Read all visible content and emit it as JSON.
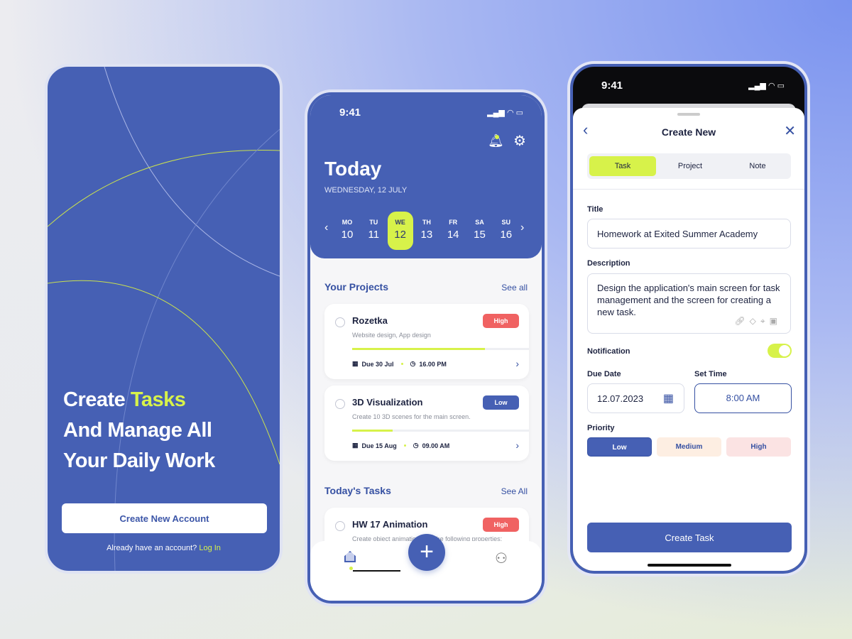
{
  "colors": {
    "primary": "#4660b4",
    "accent": "#d7f24a",
    "high": "#f06262",
    "low": "#4660b4"
  },
  "onboarding": {
    "headline_1a": "Create ",
    "headline_1b": "Tasks",
    "headline_2": "And Manage All",
    "headline_3": "Your Daily Work",
    "create_account": "Create New Account",
    "have_account": "Already have an account? ",
    "login": "Log In"
  },
  "home": {
    "time": "9:41",
    "title": "Today",
    "date": "WEDNESDAY, 12 JULY",
    "days": [
      {
        "d": "MO",
        "n": "10"
      },
      {
        "d": "TU",
        "n": "11"
      },
      {
        "d": "WE",
        "n": "12"
      },
      {
        "d": "TH",
        "n": "13"
      },
      {
        "d": "FR",
        "n": "14"
      },
      {
        "d": "SA",
        "n": "15"
      },
      {
        "d": "SU",
        "n": "16"
      }
    ],
    "projects_title": "Your Projects",
    "projects_see_all": "See all",
    "projects": [
      {
        "title": "Rozetka",
        "subtitle": "Website design, App design",
        "priority": "High",
        "progress": 0.75,
        "due": "Due 30 Jul",
        "time": "16.00 PM"
      },
      {
        "title": "3D Visualization",
        "subtitle": "Create 10 3D scenes for the main screen.",
        "priority": "Low",
        "progress": 0.23,
        "due": "Due 15 Aug",
        "time": "09.00 AM"
      }
    ],
    "tasks_title": "Today's Tasks",
    "tasks_see_all": "See All",
    "tasks": [
      {
        "title": "HW 17 Animation",
        "subtitle": "Create object animation with the following properties:",
        "priority": "High"
      }
    ]
  },
  "create": {
    "time": "9:41",
    "title": "Create New",
    "tabs": [
      "Task",
      "Project",
      "Note"
    ],
    "active_tab": "Task",
    "title_label": "Title",
    "title_value": "Homework at Exited Summer Academy",
    "desc_label": "Description",
    "desc_value": "Design the application's main screen for task management and the screen for creating a new task.",
    "notif_label": "Notification",
    "notification_on": true,
    "due_label": "Due Date",
    "due_value": "12.07.2023",
    "time_label": "Set Time",
    "time_value": "8:00 AM",
    "priority_label": "Priority",
    "priorities": [
      "Low",
      "Medium",
      "High"
    ],
    "selected_priority": "Low",
    "submit": "Create Task"
  }
}
